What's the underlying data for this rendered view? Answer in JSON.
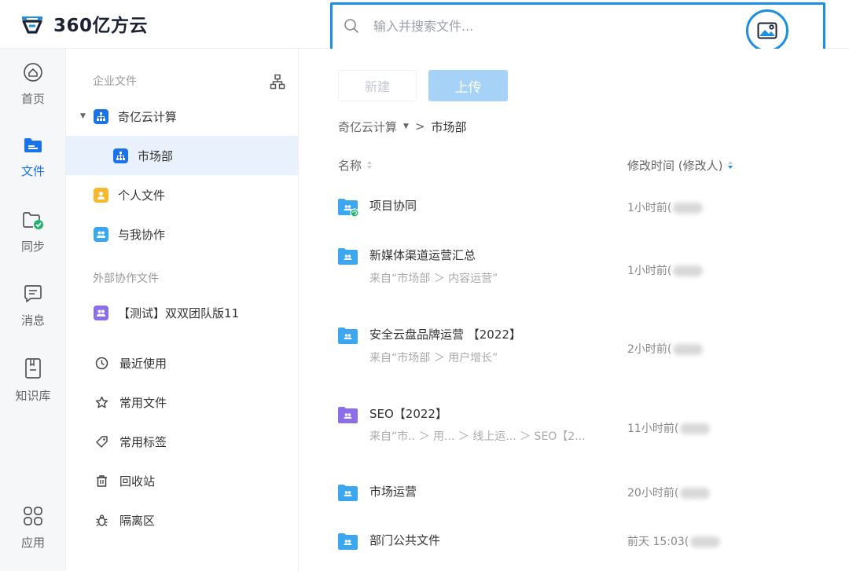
{
  "brand": {
    "logo_text": "360亿方云",
    "accent": "#1a8fe3"
  },
  "search": {
    "placeholder": "输入并搜索文件...",
    "icon": "search-icon",
    "image_search_icon": "image-search-icon"
  },
  "rail": {
    "items": [
      {
        "label": "首页",
        "icon": "home-icon"
      },
      {
        "label": "文件",
        "icon": "folder-icon",
        "active": true
      },
      {
        "label": "同步",
        "icon": "sync-folder-icon"
      },
      {
        "label": "消息",
        "icon": "message-icon"
      },
      {
        "label": "知识库",
        "icon": "book-icon"
      },
      {
        "label": "应用",
        "icon": "apps-icon"
      }
    ]
  },
  "tree": {
    "enterprise_title": "企业文件",
    "org_label": "奇亿云计算",
    "dept_label": "市场部",
    "personal_label": "个人文件",
    "collab_label": "与我协作",
    "external_title": "外部协作文件",
    "external_item": "【测试】双双团队版11",
    "recent_label": "最近使用",
    "favorite_label": "常用文件",
    "tags_label": "常用标签",
    "trash_label": "回收站",
    "quarantine_label": "隔离区"
  },
  "toolbar": {
    "new_label": "新建",
    "upload_label": "上传"
  },
  "breadcrumb": {
    "root": "奇亿云计算",
    "separator": ">",
    "current": "市场部"
  },
  "table": {
    "col_name": "名称",
    "col_modified": "修改时间 (修改人)",
    "rows": [
      {
        "name": "项目协同",
        "sub": "",
        "time": "1小时前(",
        "color": "#3aa7f0",
        "sync": true
      },
      {
        "name": "新媒体渠道运营汇总",
        "sub": "来自“市场部 ＞ 内容运营”",
        "time": "1小时前(",
        "color": "#3aa7f0"
      },
      {
        "name": "安全云盘品牌运营 【2022】",
        "sub": "来自“市场部 ＞ 用户增长”",
        "time": "2小时前(",
        "color": "#3aa7f0"
      },
      {
        "name": "SEO【2022】",
        "sub": "来自“市.. ＞ 用... ＞ 线上运... ＞ SEO【2...",
        "time": "11小时前(",
        "color": "#8b6ee8"
      },
      {
        "name": "市场运营",
        "sub": "",
        "time": "20小时前(",
        "color": "#3aa7f0"
      },
      {
        "name": "部门公共文件",
        "sub": "",
        "time": "前天 15:03(",
        "color": "#3aa7f0"
      }
    ]
  }
}
